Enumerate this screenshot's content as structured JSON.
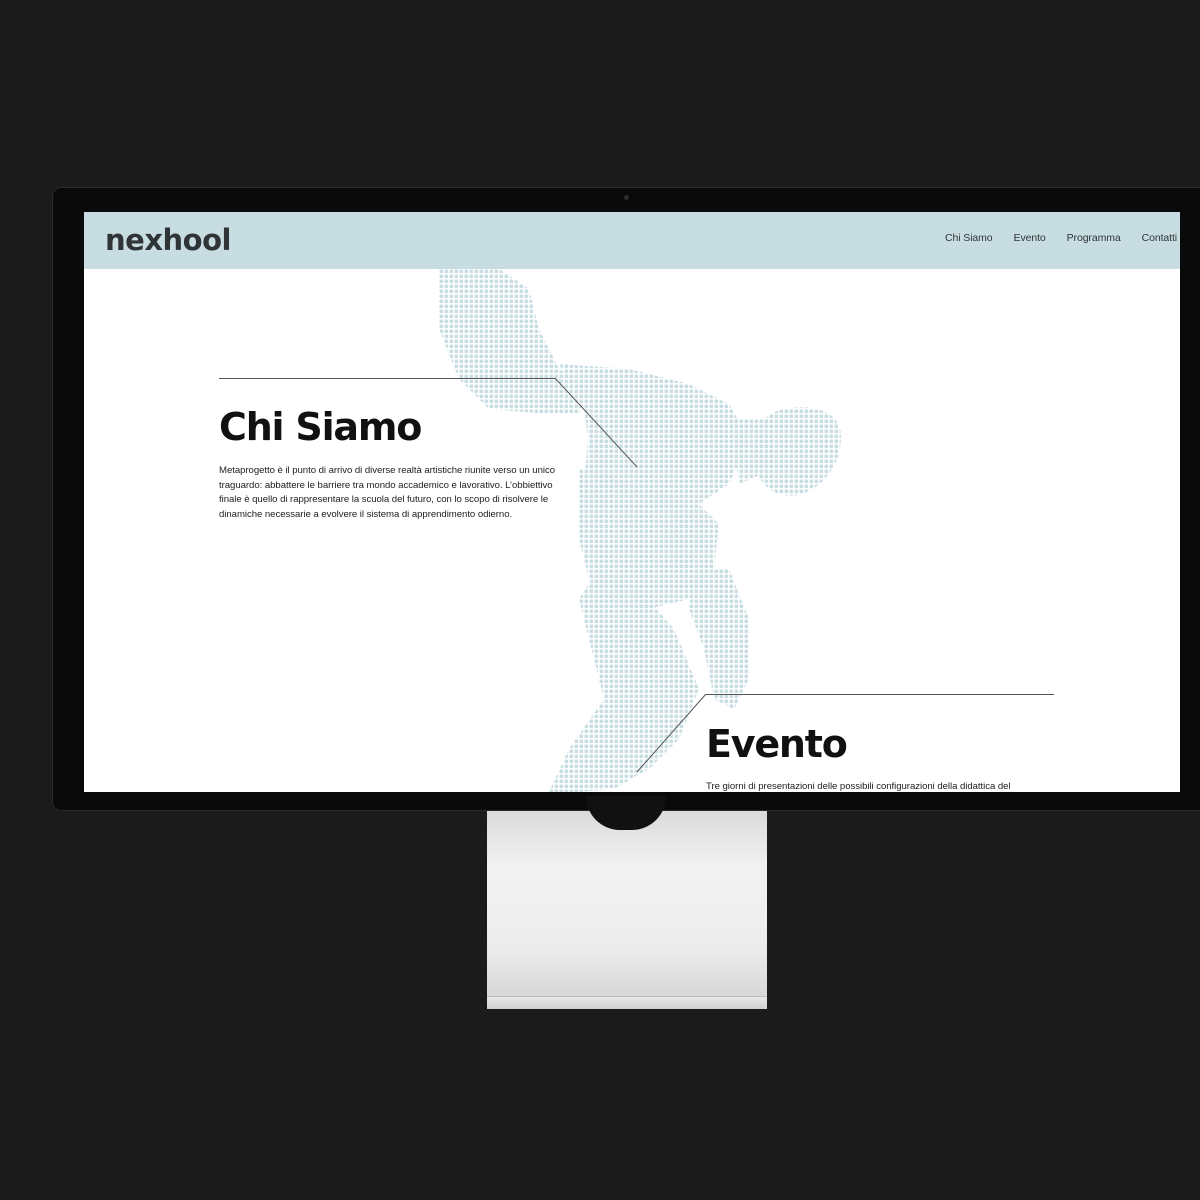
{
  "site": {
    "logo": "nexhool",
    "nav": [
      "Chi Siamo",
      "Evento",
      "Programma",
      "Contatti"
    ]
  },
  "sections": {
    "chi_siamo": {
      "title": "Chi Siamo",
      "text": "Metaprogetto è il punto di arrivo di diverse realtà artistiche riunite verso un unico traguardo: abbattere le barriere tra mondo accademico e lavorativo. L’obbiettivo finale è quello di rappresentare la scuola del futuro, con lo scopo di risolvere le dinamiche necessarie a evolvere il sistema di apprendimento odierno."
    },
    "evento": {
      "title": "Evento",
      "text": "Tre giorni di presentazioni delle possibili configurazioni della didattica del"
    }
  },
  "colors": {
    "header_bg": "#c8dde2",
    "figure_dots": "#c8dde2",
    "background": "#1b1b1b"
  },
  "icons": {
    "figure": "discobolus-halftone-figure"
  }
}
